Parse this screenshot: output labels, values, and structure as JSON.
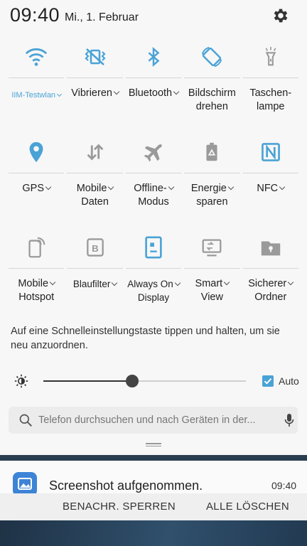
{
  "header": {
    "time": "09:40",
    "date": "Mi., 1. Februar"
  },
  "colors": {
    "active": "#4aa3d6",
    "inactive": "#9a9a9a"
  },
  "tiles": [
    {
      "name": "wifi",
      "label1": "IIM-Testwlan",
      "label2": "",
      "active": true,
      "chevron": true,
      "icon": "wifi-icon"
    },
    {
      "name": "vibrate",
      "label1": "Vibrieren",
      "label2": "",
      "active": true,
      "chevron": true,
      "icon": "vibrate-icon"
    },
    {
      "name": "bluetooth",
      "label1": "Bluetooth",
      "label2": "",
      "active": true,
      "chevron": true,
      "icon": "bluetooth-icon"
    },
    {
      "name": "rotate",
      "label1": "Bildschirm",
      "label2": "drehen",
      "active": true,
      "chevron": false,
      "icon": "screen-rotate-icon"
    },
    {
      "name": "flashlight",
      "label1": "Taschen-",
      "label2": "lampe",
      "active": false,
      "chevron": false,
      "icon": "flashlight-icon"
    },
    {
      "name": "gps",
      "label1": "GPS",
      "label2": "",
      "active": true,
      "chevron": true,
      "icon": "location-pin-icon"
    },
    {
      "name": "mobile-data",
      "label1": "Mobile",
      "label2": "Daten",
      "active": false,
      "chevron": true,
      "icon": "data-arrows-icon"
    },
    {
      "name": "airplane",
      "label1": "Offline-",
      "label2": "Modus",
      "active": false,
      "chevron": true,
      "icon": "airplane-icon"
    },
    {
      "name": "power-saving",
      "label1": "Energie",
      "label2": "sparen",
      "active": false,
      "chevron": true,
      "icon": "battery-recycle-icon"
    },
    {
      "name": "nfc",
      "label1": "NFC",
      "label2": "",
      "active": true,
      "chevron": true,
      "icon": "nfc-icon"
    },
    {
      "name": "hotspot",
      "label1": "Mobile",
      "label2": "Hotspot",
      "active": false,
      "chevron": true,
      "icon": "hotspot-icon"
    },
    {
      "name": "bluelight",
      "label1": "Blaufilter",
      "label2": "",
      "active": false,
      "chevron": true,
      "icon": "blue-filter-icon"
    },
    {
      "name": "always-on",
      "label1": "Always On",
      "label2": "Display",
      "active": true,
      "chevron": true,
      "icon": "always-on-display-icon"
    },
    {
      "name": "smart-view",
      "label1": "Smart",
      "label2": "View",
      "active": false,
      "chevron": true,
      "icon": "smart-view-icon"
    },
    {
      "name": "secure-folder",
      "label1": "Sicherer",
      "label2": "Ordner",
      "active": false,
      "chevron": true,
      "icon": "secure-folder-icon"
    }
  ],
  "hint": "Auf eine Schnelleinstellungstaste tippen und halten, um sie neu anzuordnen.",
  "brightness": {
    "level_percent": 44,
    "auto_label": "Auto",
    "auto_checked": true
  },
  "search": {
    "placeholder": "Telefon durchsuchen und nach Geräten in der..."
  },
  "notification": {
    "title": "Screenshot aufgenommen.",
    "time": "09:40"
  },
  "actions": {
    "block": "BENACHR. SPERREN",
    "clear": "ALLE LÖSCHEN"
  }
}
